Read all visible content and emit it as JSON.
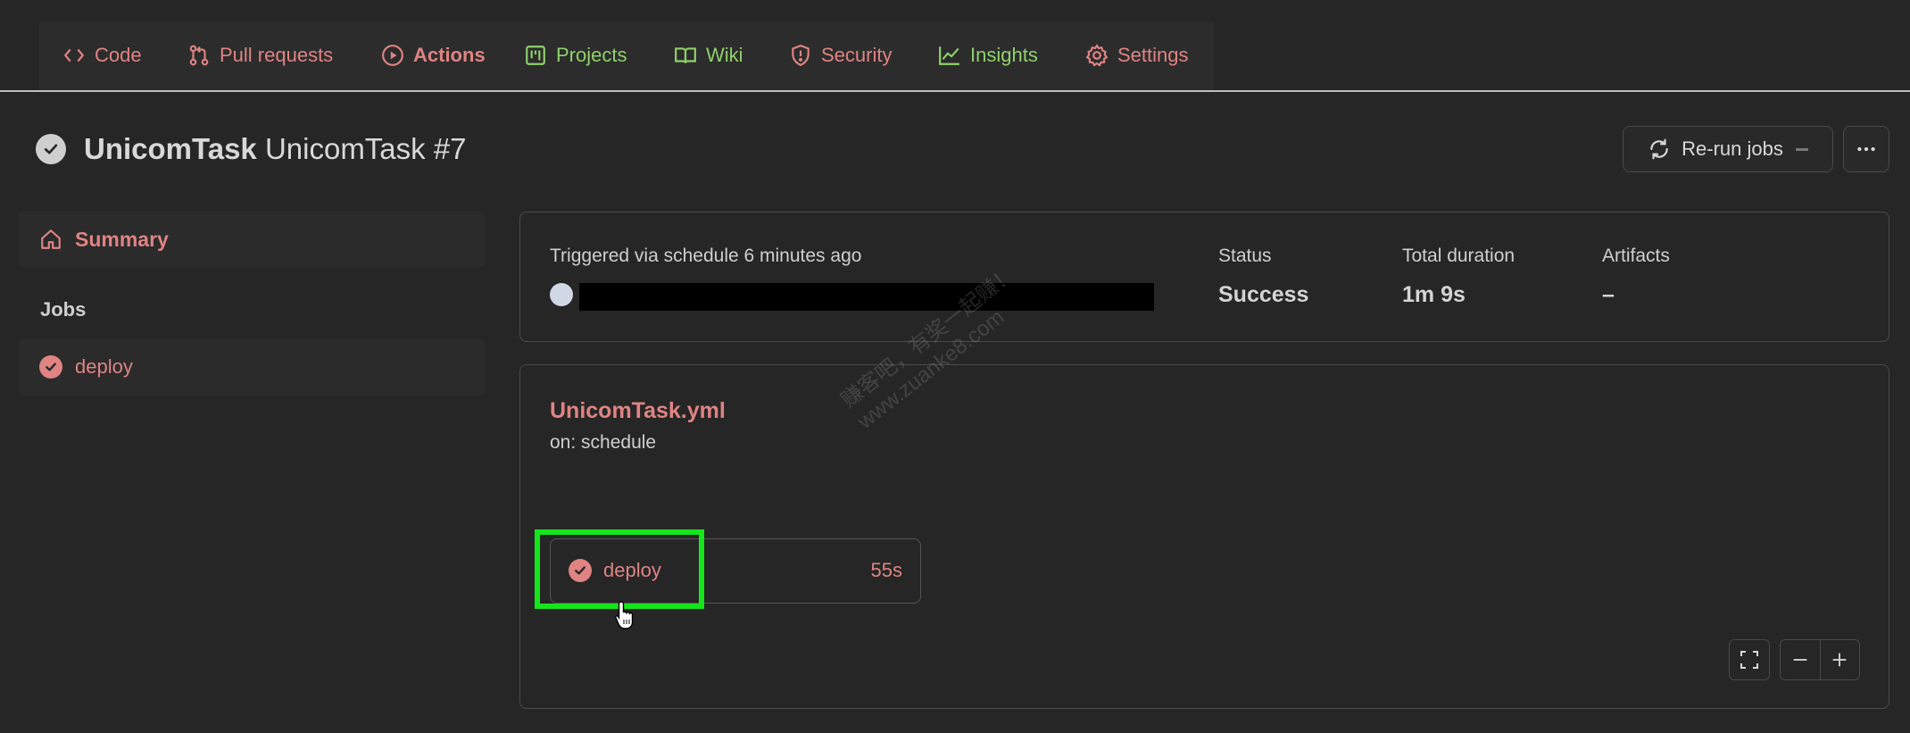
{
  "nav": {
    "items": [
      {
        "label": "Code",
        "icon": "code-icon",
        "color": "#e08383"
      },
      {
        "label": "Pull requests",
        "icon": "git-pull-request-icon",
        "color": "#e08383"
      },
      {
        "label": "Actions",
        "icon": "play-circle-icon",
        "color": "#e08383"
      },
      {
        "label": "Projects",
        "icon": "project-board-icon",
        "color": "#8fd16a"
      },
      {
        "label": "Wiki",
        "icon": "book-icon",
        "color": "#8fd16a"
      },
      {
        "label": "Security",
        "icon": "shield-icon",
        "color": "#e08383"
      },
      {
        "label": "Insights",
        "icon": "graph-icon",
        "color": "#8fd16a"
      },
      {
        "label": "Settings",
        "icon": "gear-icon",
        "color": "#e08383"
      }
    ],
    "active": "Actions"
  },
  "header": {
    "workflow_name": "UnicomTask",
    "run_title": "UnicomTask #7",
    "rerun_label": "Re-run jobs"
  },
  "sidebar": {
    "summary_label": "Summary",
    "jobs_heading": "Jobs",
    "jobs": [
      {
        "name": "deploy",
        "status": "success"
      }
    ]
  },
  "summary": {
    "trigger_text": "Triggered via schedule 6 minutes ago",
    "status_label": "Status",
    "status_value": "Success",
    "duration_label": "Total duration",
    "duration_value": "1m 9s",
    "artifacts_label": "Artifacts",
    "artifacts_value": "–"
  },
  "workflow": {
    "file": "UnicomTask.yml",
    "on": "on: schedule",
    "job": {
      "name": "deploy",
      "duration": "55s",
      "status": "success"
    }
  },
  "watermark": {
    "line1": "赚客吧，有奖一起赚！",
    "line2": "www.zuanke8.com"
  },
  "colors": {
    "accent_red": "#e08383",
    "accent_green": "#8fd16a",
    "highlight": "#13e61a",
    "background": "#262626"
  }
}
